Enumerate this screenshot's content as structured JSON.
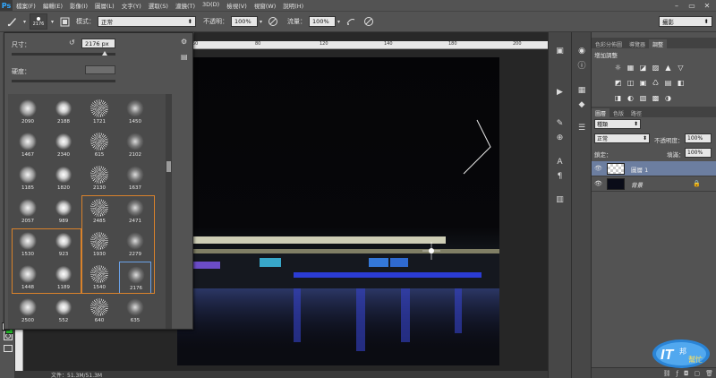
{
  "app": {
    "logo": "Ps"
  },
  "menu": [
    "檔案(F)",
    "編輯(E)",
    "影像(I)",
    "圖層(L)",
    "文字(Y)",
    "選取(S)",
    "濾鏡(T)",
    "3D(D)",
    "檢視(V)",
    "視窗(W)",
    "說明(H)"
  ],
  "window_controls": [
    "–",
    "▭",
    "✕"
  ],
  "options": {
    "brush_size": "2176",
    "mode_label": "模式：",
    "mode_value": "正常",
    "opacity_label": "不透明：",
    "opacity_value": "100%",
    "flow_label": "流量：",
    "flow_value": "100%",
    "workspace_value": "攝影"
  },
  "brush_panel": {
    "size_label": "尺寸：",
    "size_value": "2176 px",
    "hardness_label": "硬度：",
    "size_slider": 0.9,
    "brushes": [
      [
        "2090",
        "2188",
        "1721",
        "1450"
      ],
      [
        "1467",
        "2340",
        "615",
        "2102"
      ],
      [
        "1185",
        "1820",
        "2130",
        "1637"
      ],
      [
        "2057",
        "989",
        "2485",
        "2471"
      ],
      [
        "1530",
        "923",
        "1930",
        "2279"
      ],
      [
        "1448",
        "1189",
        "1540",
        "2176"
      ],
      [
        "2500",
        "552",
        "640",
        "635"
      ]
    ],
    "selected": "2176"
  },
  "right_panel": {
    "top_tabs": [
      "色彩分佈圖",
      "導覽器",
      "調整"
    ],
    "adjust_title": "增加調整",
    "layer_tabs": [
      "圖層",
      "色版",
      "路徑"
    ],
    "kind_value": "種類",
    "blend_value": "正常",
    "opacity_label": "不透明度：",
    "opacity_value": "100%",
    "lock_label": "鎖定：",
    "fill_label": "填滿：",
    "fill_value": "100%",
    "layers": [
      {
        "name": "圖層 1",
        "active": true
      },
      {
        "name": "背景",
        "active": false
      }
    ]
  },
  "status": {
    "text": "文件：51.3M/51.3M"
  },
  "colors": {
    "foreground": "#ffffff",
    "background": "#25c22c",
    "selection": "#d9822b",
    "highlight": "#6ba2e8"
  }
}
